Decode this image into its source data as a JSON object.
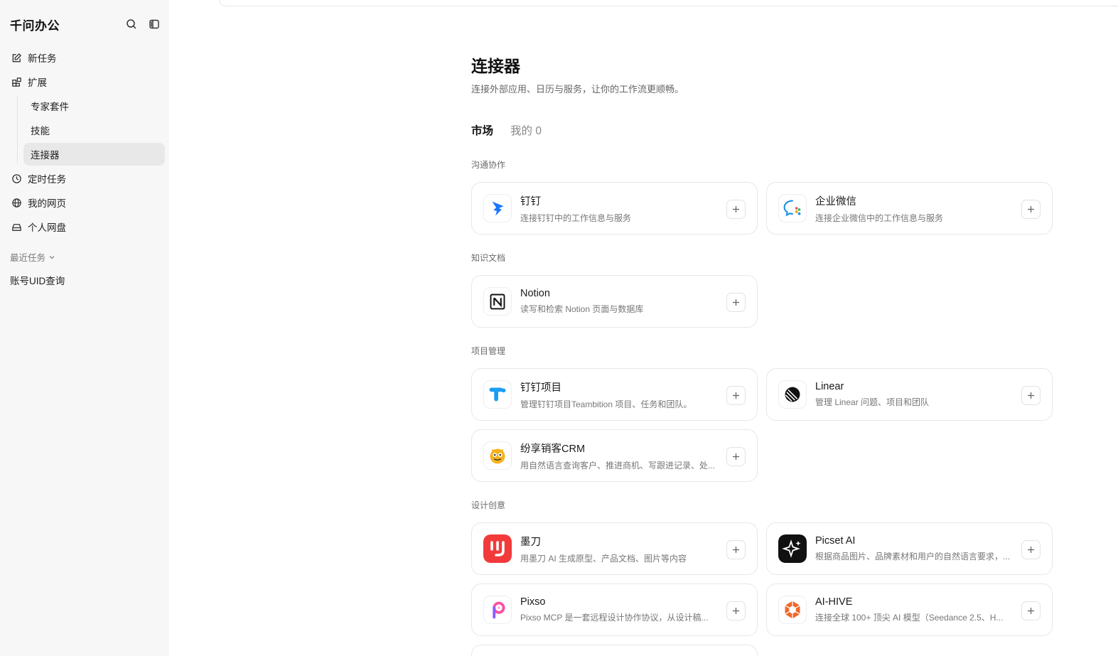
{
  "sidebar": {
    "brand": "千问办公",
    "nav": {
      "new_task": "新任务",
      "extend": "扩展",
      "expert_kit": "专家套件",
      "skills": "技能",
      "connectors": "连接器",
      "scheduled": "定时任务",
      "my_pages": "我的网页",
      "drive": "个人网盘"
    },
    "recent_header": "最近任务",
    "recent_items": [
      "账号UID查询"
    ]
  },
  "page": {
    "title": "连接器",
    "description": "连接外部应用、日历与服务，让你的工作流更顺畅。",
    "tabs": {
      "market": "市场",
      "mine": "我的 0"
    }
  },
  "sections": {
    "comm": {
      "title": "沟通协作",
      "items": [
        {
          "name": "钉钉",
          "desc": "连接钉钉中的工作信息与服务"
        },
        {
          "name": "企业微信",
          "desc": "连接企业微信中的工作信息与服务"
        }
      ]
    },
    "knowledge": {
      "title": "知识文档",
      "items": [
        {
          "name": "Notion",
          "desc": "读写和检索 Notion 页面与数据库"
        }
      ]
    },
    "project": {
      "title": "项目管理",
      "items": [
        {
          "name": "钉钉项目",
          "desc": "管理钉钉项目Teambition 项目、任务和团队。"
        },
        {
          "name": "Linear",
          "desc": "管理 Linear 问题、项目和团队"
        },
        {
          "name": "纷享销客CRM",
          "desc": "用自然语言查询客户、推进商机、写跟进记录、处..."
        }
      ]
    },
    "design": {
      "title": "设计创意",
      "items": [
        {
          "name": "墨刀",
          "desc": "用墨刀 AI 生成原型、产品文档、图片等内容"
        },
        {
          "name": "Picset AI",
          "desc": "根据商品图片、品牌素材和用户的自然语言要求，..."
        },
        {
          "name": "Pixso",
          "desc": "Pixso MCP 是一套远程设计协作协议，从设计稿..."
        },
        {
          "name": "AI-HIVE",
          "desc": "连接全球 100+ 顶尖 AI 模型（Seedance 2.5、H..."
        }
      ]
    }
  },
  "colors": {
    "sidebar_bg": "#f7f7f7",
    "active_item_bg": "#e8e8e8",
    "dingtalk_blue": "#1677ff",
    "modao_red": "#f23a3a",
    "pixso_pink": "#ff4fa0",
    "aihive_orange": "#f0662a"
  }
}
